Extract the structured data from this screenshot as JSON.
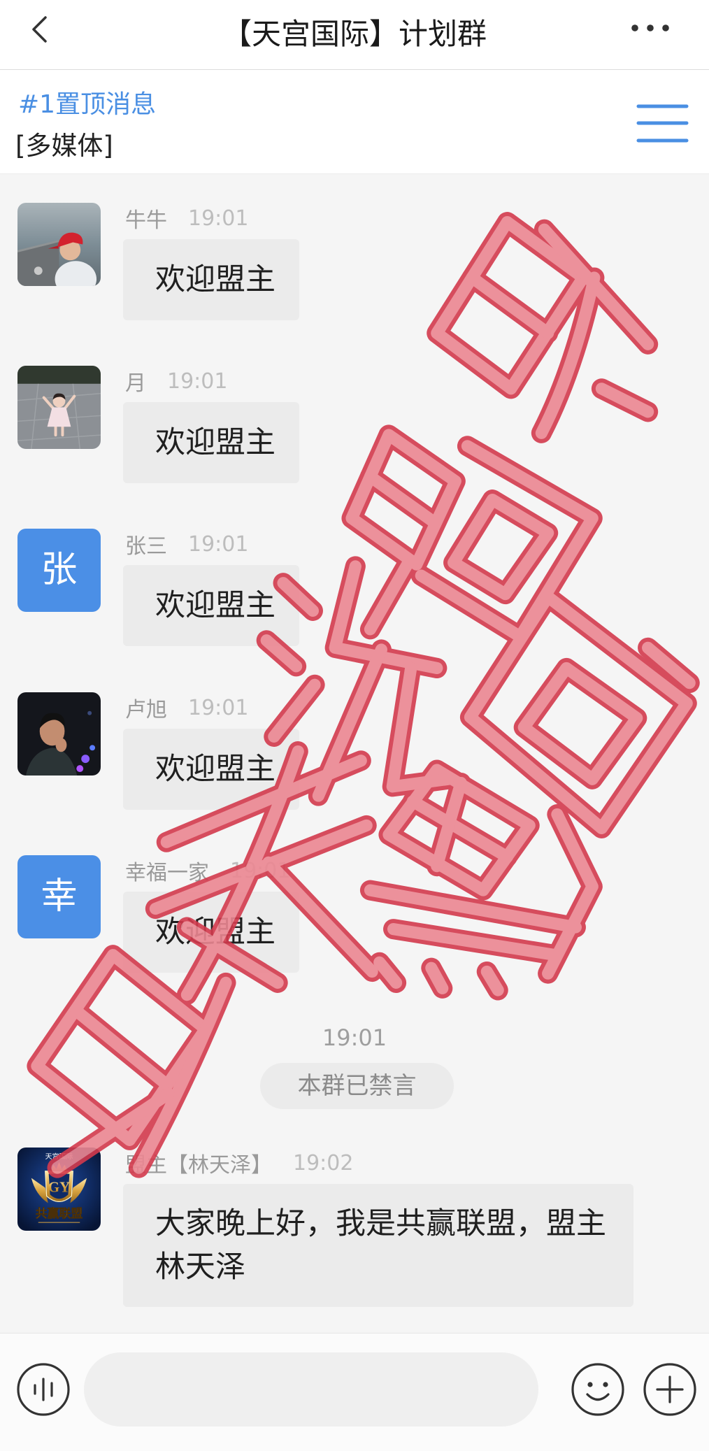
{
  "header": {
    "title": "【天宫国际】计划群"
  },
  "pinned": {
    "label": "#1置顶消息",
    "content": "[多媒体]"
  },
  "messages": [
    {
      "sender": "牛牛",
      "time": "19:01",
      "text": "欢迎盟主"
    },
    {
      "sender": "月",
      "time": "19:01",
      "text": "欢迎盟主"
    },
    {
      "sender": "张三",
      "time": "19:01",
      "text": "欢迎盟主",
      "avatar_initial": "张"
    },
    {
      "sender": "卢旭",
      "time": "19:01",
      "text": "欢迎盟主"
    },
    {
      "sender": "幸福一家",
      "time": "19:01",
      "text": "欢迎盟主",
      "avatar_initial": "幸"
    },
    {
      "sender": "盟主【林天泽】",
      "time": "19:02",
      "text": "大家晚上好，我是共赢联盟，盟主林天泽",
      "avatar_logo": {
        "top": "天宫国际",
        "mark": "GY",
        "bottom": "共赢联盟"
      }
    }
  ],
  "system_notice": {
    "time": "19:01",
    "text": "本群已禁言"
  },
  "composer": {
    "input_value": ""
  },
  "icons": {
    "back": "chevron-left-icon",
    "more": "more-dots-icon",
    "menu": "hamburger-menu-icon",
    "voice": "voice-icon",
    "emoji": "smiley-icon",
    "add": "plus-icon"
  },
  "colors": {
    "accent": "#4a8fe3",
    "avatar_blue": "#4b8fe6",
    "bubble": "#ebebeb",
    "watermark": "#d33a4d"
  }
}
